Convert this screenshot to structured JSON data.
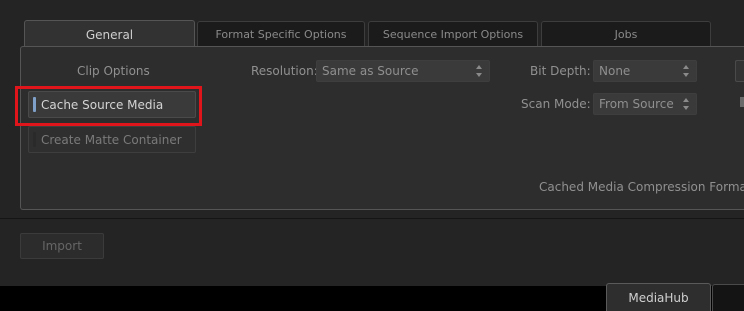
{
  "tabs": [
    {
      "label": "General",
      "active": true
    },
    {
      "label": "Format Specific Options",
      "active": false
    },
    {
      "label": "Sequence Import Options",
      "active": false
    },
    {
      "label": "Jobs",
      "active": false
    }
  ],
  "clip_options": {
    "heading": "Clip Options",
    "cache_source_media": {
      "label": "Cache Source Media",
      "enabled": true
    },
    "create_matte_container": {
      "label": "Create Matte Container",
      "enabled": false
    }
  },
  "resolution": {
    "label": "Resolution:",
    "value": "Same as Source"
  },
  "bit_depth": {
    "label": "Bit Depth:",
    "value": "None"
  },
  "scan_mode": {
    "label": "Scan Mode:",
    "value": "From Source"
  },
  "cached_media_compression": {
    "label": "Cached Media Compression Format"
  },
  "import_button": {
    "label": "Import",
    "enabled": false
  },
  "bottom_tabs": [
    {
      "label": "MediaHub",
      "active": true
    },
    {
      "label": "",
      "active": false
    }
  ],
  "colors": {
    "highlight_box": "#e0141b",
    "toggle_on": "#7fa1c9",
    "background": "#242424"
  }
}
